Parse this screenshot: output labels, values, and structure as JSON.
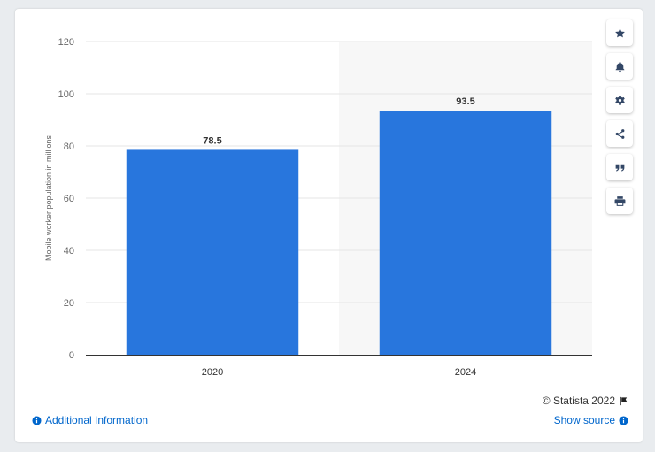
{
  "chart_data": {
    "type": "bar",
    "categories": [
      "2020",
      "2024"
    ],
    "values": [
      78.5,
      93.5
    ],
    "value_labels": [
      "78.5",
      "93.5"
    ],
    "ylabel": "Mobile worker population in millions",
    "ylim": [
      0,
      120
    ],
    "yticks": [
      0,
      20,
      40,
      60,
      80,
      100,
      120
    ],
    "grid": true,
    "highlight_category": "2024",
    "colors": {
      "bar": "#2876dd",
      "grid": "#e6e6e6",
      "highlight_bg": "#f7f7f7",
      "axis": "#333333",
      "tick_text": "#666666"
    }
  },
  "toolbar": {
    "icons": [
      "star-icon",
      "bell-icon",
      "gear-icon",
      "share-icon",
      "quote-icon",
      "print-icon"
    ]
  },
  "footer": {
    "credit": "© Statista 2022",
    "additional_info": "Additional Information",
    "show_source": "Show source"
  }
}
